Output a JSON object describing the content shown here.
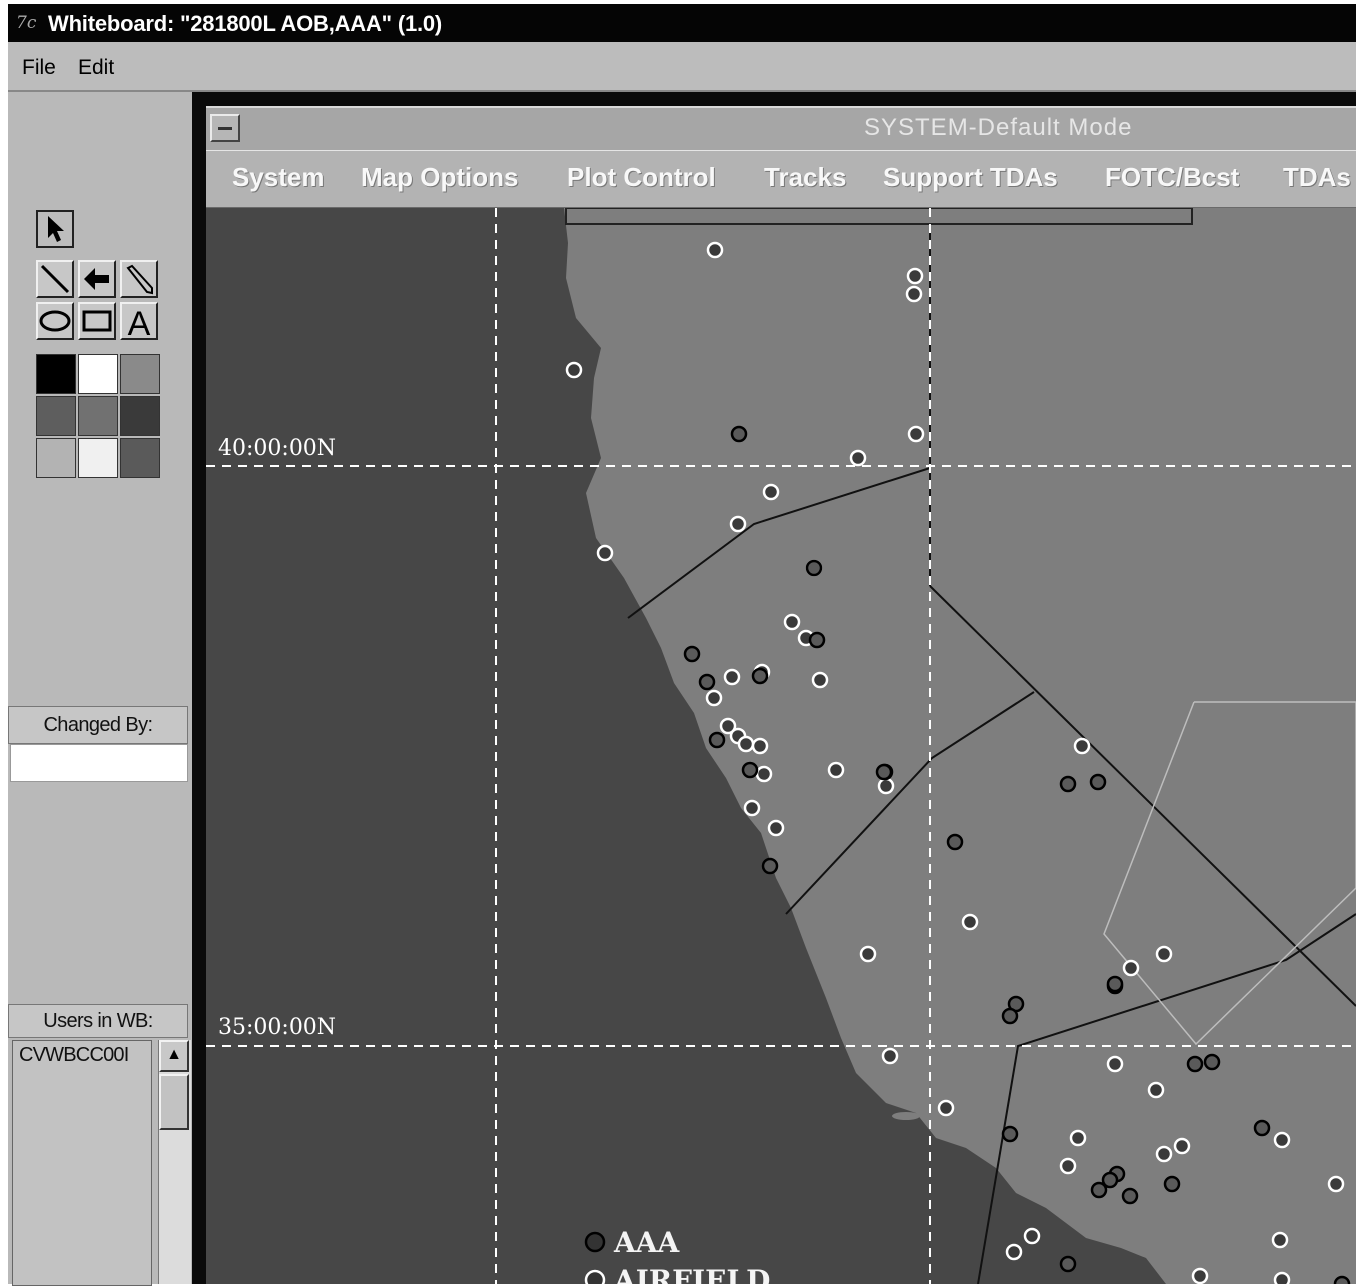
{
  "window": {
    "icon": "7c",
    "title": "Whiteboard: \"281800L AOB,AAA\" (1.0)"
  },
  "menu": {
    "file": "File",
    "edit": "Edit"
  },
  "tools": {
    "items": [
      "arrow-select-icon",
      "line-icon",
      "arrow-icon",
      "pencil-icon",
      "ellipse-icon",
      "rectangle-icon",
      "text-icon"
    ],
    "text_glyph": "A"
  },
  "palette": [
    "#000000",
    "#ffffff",
    "#8a8a8a",
    "#5e5e5e",
    "#717171",
    "#3a3a3a",
    "#b3b3b3",
    "#f0f0f0",
    "#5a5a5a"
  ],
  "changed_by": {
    "label": "Changed By:",
    "value": ""
  },
  "users": {
    "label": "Users in WB:",
    "items": [
      "CVWBCC00I"
    ]
  },
  "inner_window": {
    "mode_title": "SYSTEM-Default Mode",
    "menu": [
      "System",
      "Map Options",
      "Plot Control",
      "Tracks",
      "Support TDAs",
      "FOTC/Bcst",
      "TDAs"
    ]
  },
  "map": {
    "lat_labels": [
      "40:00:00N",
      "35:00:00N"
    ],
    "legend": [
      "AAA",
      "AIRFIELD"
    ],
    "colors": {
      "ocean": "#474747",
      "land": "#7e7e7e",
      "grid": "#ffffff",
      "border": "#111111"
    }
  }
}
